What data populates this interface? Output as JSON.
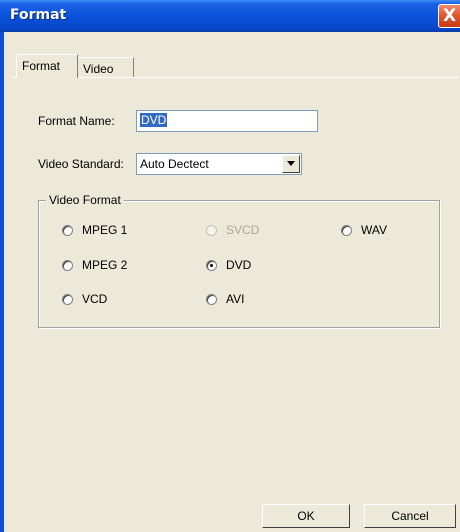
{
  "window": {
    "title": "Format",
    "close_glyph": "X"
  },
  "tabs": [
    {
      "label": "Format",
      "active": true
    },
    {
      "label": "Video",
      "active": false
    }
  ],
  "fields": {
    "format_name_label": "Format Name:",
    "format_name_value": "DVD",
    "video_standard_label": "Video Standard:",
    "video_standard_value": "Auto Dectect"
  },
  "video_format": {
    "title": "Video Format",
    "options": [
      {
        "label": "MPEG 1",
        "checked": false,
        "disabled": false
      },
      {
        "label": "SVCD",
        "checked": false,
        "disabled": true
      },
      {
        "label": "WAV",
        "checked": false,
        "disabled": false
      },
      {
        "label": "MPEG 2",
        "checked": false,
        "disabled": false
      },
      {
        "label": "DVD",
        "checked": true,
        "disabled": false
      },
      {
        "label": "VCD",
        "checked": false,
        "disabled": false
      },
      {
        "label": "AVI",
        "checked": false,
        "disabled": false
      }
    ]
  },
  "buttons": {
    "ok": "OK",
    "cancel": "Cancel"
  },
  "colors": {
    "title_bar": "#0a52db",
    "close_button": "#e05530",
    "selection": "#316ac5",
    "dialog_bg": "#ece9d8"
  },
  "icons": {
    "close": "close-icon",
    "dropdown": "chevron-down-icon"
  }
}
